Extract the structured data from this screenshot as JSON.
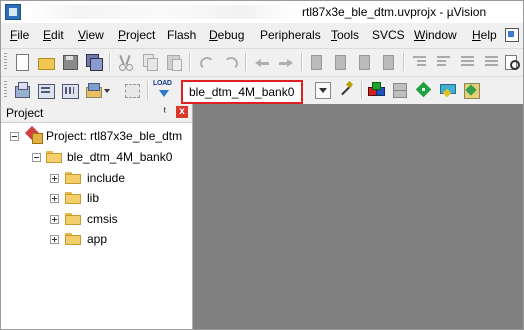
{
  "window": {
    "title": "rtl87x3e_ble_dtm.uvprojx - µVision"
  },
  "menu": {
    "items": [
      {
        "underline": "F",
        "rest": "ile"
      },
      {
        "underline": "E",
        "rest": "dit"
      },
      {
        "underline": "V",
        "rest": "iew"
      },
      {
        "underline": "P",
        "rest": "roject"
      },
      {
        "underline": "",
        "rest": "Flash"
      },
      {
        "underline": "D",
        "rest": "ebug"
      },
      {
        "underline": "",
        "rest": "Peripherals"
      },
      {
        "underline": "T",
        "rest": "ools"
      },
      {
        "underline": "",
        "rest": "SVCS"
      },
      {
        "underline": "W",
        "rest": "indow"
      },
      {
        "underline": "H",
        "rest": "elp"
      }
    ]
  },
  "toolbar2": {
    "load_label": "LOAD",
    "target": "ble_dtm_4M_bank0"
  },
  "project_pane": {
    "title": "Project",
    "pin_glyph": "ᵗ",
    "close_glyph": "x",
    "root": "Project: rtl87x3e_ble_dtm",
    "target": "ble_dtm_4M_bank0",
    "groups": [
      "include",
      "lib",
      "cmsis",
      "app"
    ]
  },
  "colors": {
    "highlight_border": "#e02020",
    "editor_background": "#808080"
  }
}
